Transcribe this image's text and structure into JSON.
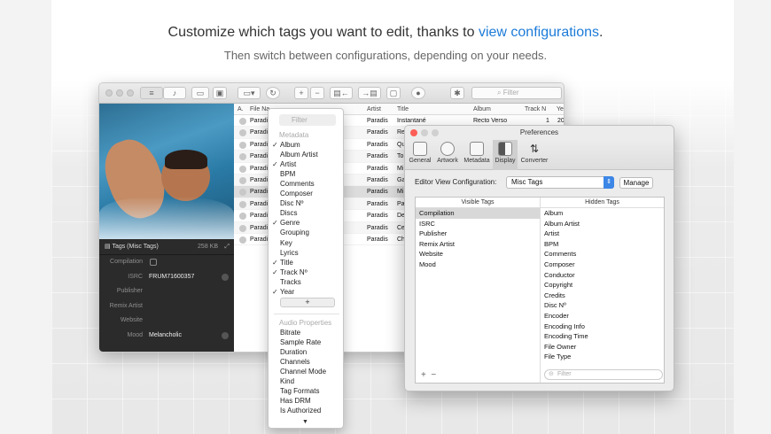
{
  "header": {
    "headline_pre": "Customize which tags you want to edit, thanks to ",
    "headline_link": "view configurations",
    "headline_post": ".",
    "subline": "Then switch between configurations, depending on your needs."
  },
  "toolbar": {
    "search_placeholder": "Filter"
  },
  "side_panel": {
    "title": "Tags (Misc Tags)",
    "size": "258 KB",
    "fields": [
      {
        "label": "Compilation",
        "value": ""
      },
      {
        "label": "ISRC",
        "value": "FRUM71600357"
      },
      {
        "label": "Publisher",
        "value": ""
      },
      {
        "label": "Remix Artist",
        "value": ""
      },
      {
        "label": "Website",
        "value": ""
      },
      {
        "label": "Mood",
        "value": "Melancholic"
      }
    ]
  },
  "table": {
    "headers": {
      "a": "A.",
      "file": "File Na",
      "artist": "Artist",
      "title": "Title",
      "album": "Album",
      "track": "Track N",
      "year": "Ye"
    },
    "rows": [
      {
        "file": "Paradi",
        "mid": "",
        "artist": "Paradis",
        "title": "Instantané",
        "album": "Recto Verso",
        "track": "1",
        "year": "20"
      },
      {
        "file": "Paradi",
        "mid": "",
        "artist": "Paradis",
        "title": "Re",
        "album": "",
        "track": "",
        "year": ""
      },
      {
        "file": "Paradi",
        "mid": "",
        "artist": "Paradis",
        "title": "Qu",
        "album": "",
        "track": "",
        "year": ""
      },
      {
        "file": "Paradi",
        "mid": "",
        "artist": "Paradis",
        "title": "To",
        "album": "",
        "track": "",
        "year": ""
      },
      {
        "file": "Paradi",
        "mid": "",
        "artist": "Paradis",
        "title": "Mi",
        "album": "",
        "track": "",
        "year": ""
      },
      {
        "file": "Paradi",
        "mid": "",
        "artist": "Paradis",
        "title": "Ga",
        "album": "",
        "track": "",
        "year": ""
      },
      {
        "file": "Paradi",
        "mid": "",
        "artist": "Paradis",
        "title": "Mi",
        "album": "",
        "track": "",
        "year": ""
      },
      {
        "file": "Paradi",
        "mid": "",
        "artist": "Paradis",
        "title": "Pa",
        "album": "",
        "track": "",
        "year": ""
      },
      {
        "file": "Paradi",
        "mid": "e.mp3",
        "artist": "Paradis",
        "title": "De",
        "album": "",
        "track": "",
        "year": ""
      },
      {
        "file": "Paradi",
        "mid": "",
        "artist": "Paradis",
        "title": "Ce",
        "album": "",
        "track": "",
        "year": ""
      },
      {
        "file": "Paradi",
        "mid": "",
        "artist": "Paradis",
        "title": "Ch",
        "album": "",
        "track": "",
        "year": ""
      }
    ]
  },
  "dropdown": {
    "search_placeholder": "Filter",
    "section_metadata": "Metadata",
    "metadata_items": [
      {
        "label": "Album",
        "checked": "✓"
      },
      {
        "label": "Album Artist",
        "checked": ""
      },
      {
        "label": "Artist",
        "checked": "✓"
      },
      {
        "label": "BPM",
        "checked": ""
      },
      {
        "label": "Comments",
        "checked": ""
      },
      {
        "label": "Composer",
        "checked": ""
      },
      {
        "label": "Disc Nº",
        "checked": ""
      },
      {
        "label": "Discs",
        "checked": ""
      },
      {
        "label": "Genre",
        "checked": "✓"
      },
      {
        "label": "Grouping",
        "checked": ""
      },
      {
        "label": "Key",
        "checked": ""
      },
      {
        "label": "Lyrics",
        "checked": ""
      },
      {
        "label": "Title",
        "checked": "✓"
      },
      {
        "label": "Track Nº",
        "checked": "✓"
      },
      {
        "label": "Tracks",
        "checked": ""
      },
      {
        "label": "Year",
        "checked": "✓"
      }
    ],
    "plus": "+",
    "section_audio": "Audio Properties",
    "audio_items": [
      "Bitrate",
      "Sample Rate",
      "Duration",
      "Channels",
      "Channel Mode",
      "Kind",
      "Tag Formats",
      "Has DRM",
      "Is Authorized"
    ],
    "more": "▼"
  },
  "prefs": {
    "title": "Preferences",
    "tabs": [
      "General",
      "Artwork",
      "Metadata",
      "Display",
      "Converter"
    ],
    "editor_label": "Editor View Configuration:",
    "editor_value": "Misc Tags",
    "manage": "Manage",
    "visible_header": "Visible Tags",
    "hidden_header": "Hidden Tags",
    "visible": [
      "Compilation",
      "ISRC",
      "Publisher",
      "Remix Artist",
      "Website",
      "Mood"
    ],
    "hidden": [
      "Album",
      "Album Artist",
      "Artist",
      "BPM",
      "Comments",
      "Composer",
      "Conductor",
      "Copyright",
      "Credits",
      "Disc Nº",
      "Encoder",
      "Encoding Info",
      "Encoding Time",
      "File Owner",
      "File Type"
    ],
    "add": "+",
    "remove": "−",
    "filter_placeholder": "Filter"
  }
}
